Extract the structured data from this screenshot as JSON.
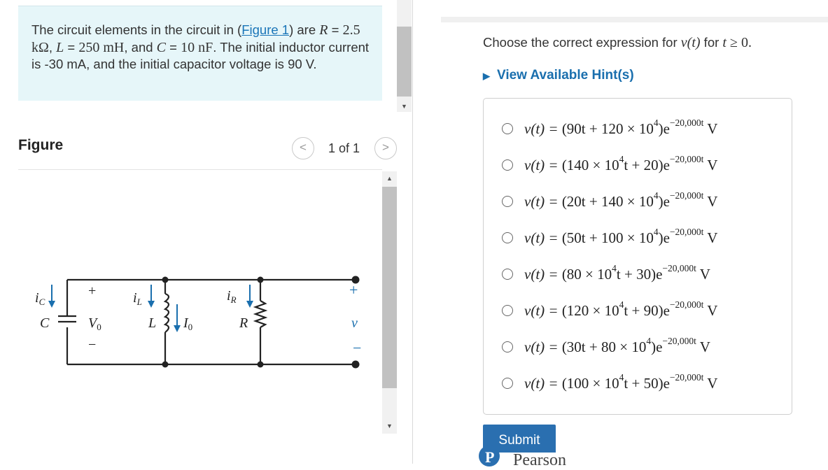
{
  "problem": {
    "text_before_link": "The circuit elements in the circuit in (",
    "link_text": "Figure 1",
    "text_after_link": ") are ",
    "R_symbol": "R",
    "R_value": "2.5 kΩ",
    "L_symbol": "L",
    "L_value": "250 mH",
    "C_symbol": "C",
    "C_value": "10 nF",
    "initial_current_text": "The initial inductor current is -30 mA, and the initial capacitor voltage is 90 V."
  },
  "figure": {
    "heading": "Figure",
    "page_counter": "1 of 1",
    "prev_icon": "<",
    "next_icon": ">",
    "labels": {
      "ic": "i",
      "ic_sub": "C",
      "C": "C",
      "plus": "+",
      "minus": "−",
      "V0": "V",
      "V0_sub": "0",
      "iL": "i",
      "iL_sub": "L",
      "L": "L",
      "I0": "I",
      "I0_sub": "0",
      "iR": "i",
      "iR_sub": "R",
      "R": "R",
      "v": "v",
      "v_plus": "+",
      "v_minus": "−"
    }
  },
  "question": {
    "prefix": "Choose the correct expression for ",
    "expr": "v(t)",
    "middle": " for ",
    "cond_var": "t",
    "cond": " ≥ 0."
  },
  "hint": {
    "label": "View Available Hint(s)"
  },
  "choices": [
    {
      "lhs": "v(t) = ",
      "body": "(90t + 120 × 10",
      "exp4": "4",
      "tail": ")e",
      "exponent": "−20,000t",
      "unit": " V"
    },
    {
      "lhs": "v(t) = ",
      "body": "(140 × 10",
      "exp4": "4",
      "tail": "t + 20)e",
      "exponent": "−20,000t",
      "unit": " V"
    },
    {
      "lhs": "v(t) = ",
      "body": "(20t + 140 × 10",
      "exp4": "4",
      "tail": ")e",
      "exponent": "−20,000t",
      "unit": " V"
    },
    {
      "lhs": "v(t) = ",
      "body": "(50t + 100 × 10",
      "exp4": "4",
      "tail": ")e",
      "exponent": "−20,000t",
      "unit": " V"
    },
    {
      "lhs": "v(t) = ",
      "body": "(80 × 10",
      "exp4": "4",
      "tail": "t + 30)e",
      "exponent": "−20,000t",
      "unit": " V"
    },
    {
      "lhs": "v(t) = ",
      "body": "(120 × 10",
      "exp4": "4",
      "tail": "t + 90)e",
      "exponent": "−20,000t",
      "unit": " V"
    },
    {
      "lhs": "v(t) = ",
      "body": "(30t + 80 × 10",
      "exp4": "4",
      "tail": ")e",
      "exponent": "−20,000t",
      "unit": " V"
    },
    {
      "lhs": "v(t) = ",
      "body": "(100 × 10",
      "exp4": "4",
      "tail": "t + 50)e",
      "exponent": "−20,000t",
      "unit": " V"
    }
  ],
  "submit": {
    "label": "Submit"
  },
  "brand": {
    "name": "Pearson",
    "color": "#2a6fb0"
  },
  "colors": {
    "accent": "#1a6fae",
    "problem_bg": "#e6f6f9",
    "circuit": "#222222"
  }
}
